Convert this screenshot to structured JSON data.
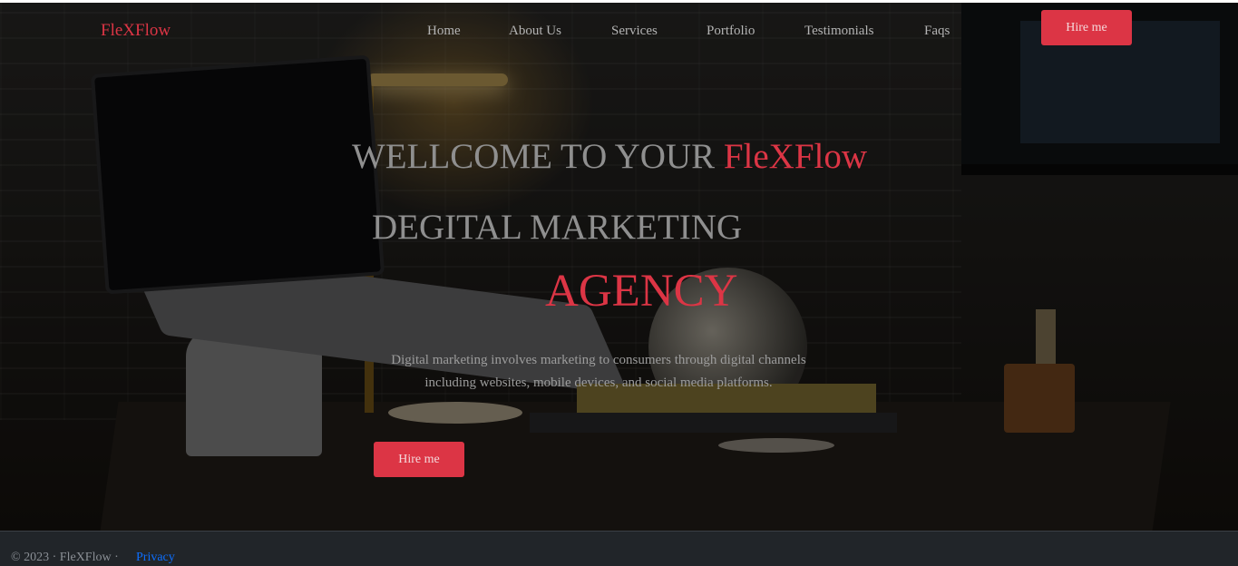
{
  "brand": "FleXFlow",
  "nav": {
    "items": [
      "Home",
      "About Us",
      "Services",
      "Portfolio",
      "Testimonials",
      "Faqs"
    ],
    "cta": "Hire me"
  },
  "hero": {
    "line1_prefix": "WELLCOME TO YOUR ",
    "line1_accent": "FleXFlow",
    "line2": "DEGITAL MARKETING",
    "line3": "AGENCY",
    "description": "Digital marketing involves marketing to consumers through digital channels including websites, mobile devices, and social media platforms.",
    "cta": "Hire me"
  },
  "footer": {
    "copyright": "© 2023 · FleXFlow ·",
    "privacy": "Privacy"
  },
  "colors": {
    "accent": "#dc3545",
    "nav_text": "#b4b4b4",
    "link": "#0d6efd",
    "footer_bg": "#212529"
  }
}
